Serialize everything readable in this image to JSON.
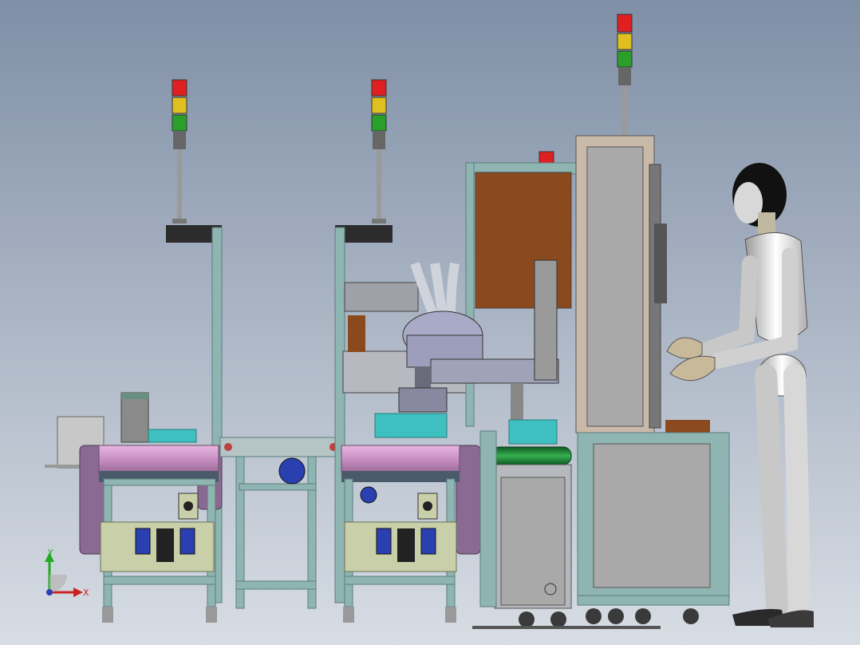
{
  "viewport": {
    "background_top": "#7f8fa6",
    "background_bottom": "#d8dde4"
  },
  "colors": {
    "frame": "#8fb5b2",
    "frame_dark": "#5b7d7a",
    "conveyor_pink": "#c98fc4",
    "conveyor_purple": "#8a6a92",
    "panel_olive": "#c9cfa9",
    "dark": "#2c2c2c",
    "light_red": "#e02020",
    "light_yellow": "#e0c020",
    "light_green": "#2aa02a",
    "cabinet": "#a9a9a9",
    "brown": "#8b4a1e",
    "blue": "#2a3fb0",
    "robot_white": "#eeeeee",
    "robot_head": "#111111",
    "green_roller": "#1f8a3a",
    "cyan": "#3fc0c0"
  },
  "view_triad": {
    "x_label": "X",
    "y_label": "Y"
  },
  "components": [
    "signal-tower-left",
    "signal-tower-middle",
    "signal-tower-center",
    "signal-tower-right",
    "conveyor-station-left",
    "conveyor-station-middle",
    "scara-robot",
    "control-cabinet",
    "humanoid-operator"
  ]
}
